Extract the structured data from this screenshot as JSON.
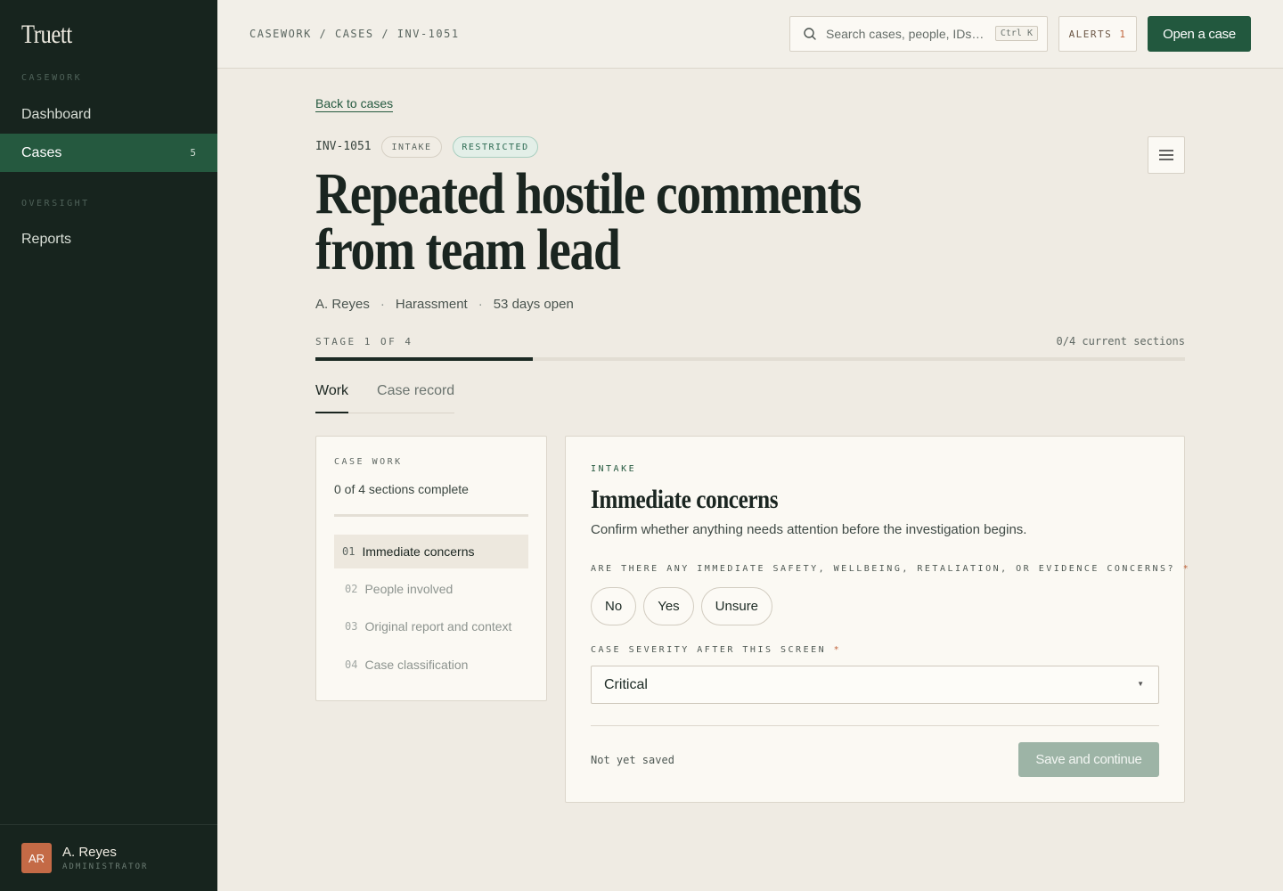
{
  "app": {
    "logo": "Truett"
  },
  "sidebar": {
    "section_casework": "CASEWORK",
    "section_oversight": "OVERSIGHT",
    "items": [
      {
        "label": "Dashboard"
      },
      {
        "label": "Cases",
        "count": "5"
      },
      {
        "label": "Reports"
      }
    ],
    "user": {
      "initials": "AR",
      "name": "A. Reyes",
      "role": "ADMINISTRATOR"
    }
  },
  "topbar": {
    "breadcrumb": "CASEWORK / CASES / INV-1051",
    "search_placeholder": "Search cases, people, IDs…",
    "search_shortcut": "Ctrl K",
    "alerts_label": "ALERTS",
    "alerts_count": "1",
    "open_case_label": "Open a case"
  },
  "case": {
    "back_link": "Back to cases",
    "id": "INV-1051",
    "badges": [
      "INTAKE",
      "RESTRICTED"
    ],
    "title_line1": "Repeated hostile comments",
    "title_line2": "from team lead",
    "meta": [
      "A. Reyes",
      "Harassment",
      "53 days open"
    ],
    "stage_label": "STAGE 1 OF 4",
    "sections_status": "0/4 current sections",
    "stage_progress": 0.25
  },
  "tabs": [
    {
      "label": "Work"
    },
    {
      "label": "Case record"
    }
  ],
  "steps": {
    "label": "CASE WORK",
    "summary": "0 of 4 sections complete",
    "items": [
      {
        "num": "01",
        "label": "Immediate concerns"
      },
      {
        "num": "02",
        "label": "People involved"
      },
      {
        "num": "03",
        "label": "Original report and context"
      },
      {
        "num": "04",
        "label": "Case classification"
      }
    ]
  },
  "panel": {
    "eyebrow": "INTAKE",
    "title": "Immediate concerns",
    "description": "Confirm whether anything needs attention before the investigation begins.",
    "question1": "ARE THERE ANY IMMEDIATE SAFETY, WELLBEING, RETALIATION, OR EVIDENCE CONCERNS?",
    "options": [
      "No",
      "Yes",
      "Unsure"
    ],
    "question2": "CASE SEVERITY AFTER THIS SCREEN",
    "required_mark": "*",
    "severity_value": "Critical",
    "save_status": "Not yet saved",
    "save_button": "Save and continue"
  },
  "colors": {
    "sidebar_bg": "#17241e",
    "accent": "#22583e",
    "alert": "#c0633a",
    "disabled_button": "#9db4a6"
  },
  "icons": [
    "search-icon",
    "menu-icon",
    "chevron-down-icon"
  ]
}
